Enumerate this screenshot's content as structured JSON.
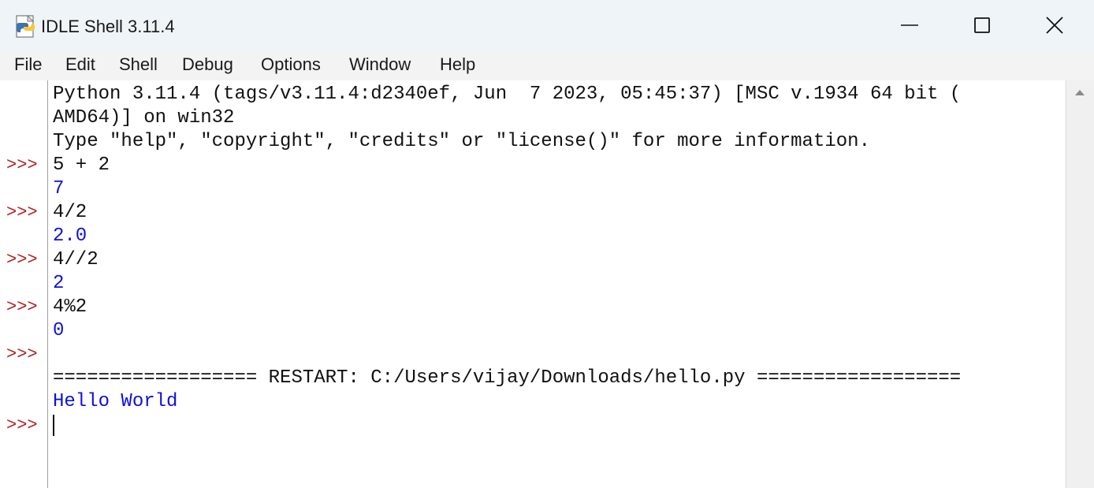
{
  "window": {
    "title": "IDLE Shell 3.11.4",
    "controls": {
      "minimize": "minimize",
      "maximize": "maximize",
      "close": "close"
    }
  },
  "menu": [
    "File",
    "Edit",
    "Shell",
    "Debug",
    "Options",
    "Window",
    "Help"
  ],
  "shell": {
    "lines": [
      {
        "text": "Python 3.11.4 (tags/v3.11.4:d2340ef, Jun  7 2023, 05:45:37) [MSC v.1934 64 bit (",
        "kind": "std"
      },
      {
        "text": "AMD64)] on win32",
        "kind": "std"
      },
      {
        "text": "Type \"help\", \"copyright\", \"credits\" or \"license()\" for more information.",
        "kind": "std"
      },
      {
        "text": "5 + 2",
        "kind": "std"
      },
      {
        "text": "7",
        "kind": "out"
      },
      {
        "text": "4/2",
        "kind": "std"
      },
      {
        "text": "2.0",
        "kind": "out"
      },
      {
        "text": "4//2",
        "kind": "std"
      },
      {
        "text": "2",
        "kind": "out"
      },
      {
        "text": "4%2",
        "kind": "std"
      },
      {
        "text": "0",
        "kind": "out"
      },
      {
        "text": "",
        "kind": "std"
      },
      {
        "text": "================== RESTART: C:/Users/vijay/Downloads/hello.py ==================",
        "kind": "std"
      },
      {
        "text": "Hello World",
        "kind": "out"
      },
      {
        "text": "",
        "kind": "std"
      }
    ],
    "prompt_symbol": ">>>",
    "prompt_rows": [
      3,
      5,
      7,
      9,
      11,
      14
    ]
  },
  "colors": {
    "prompt": "#b22222",
    "output": "#1010e0",
    "text": "#111111"
  }
}
